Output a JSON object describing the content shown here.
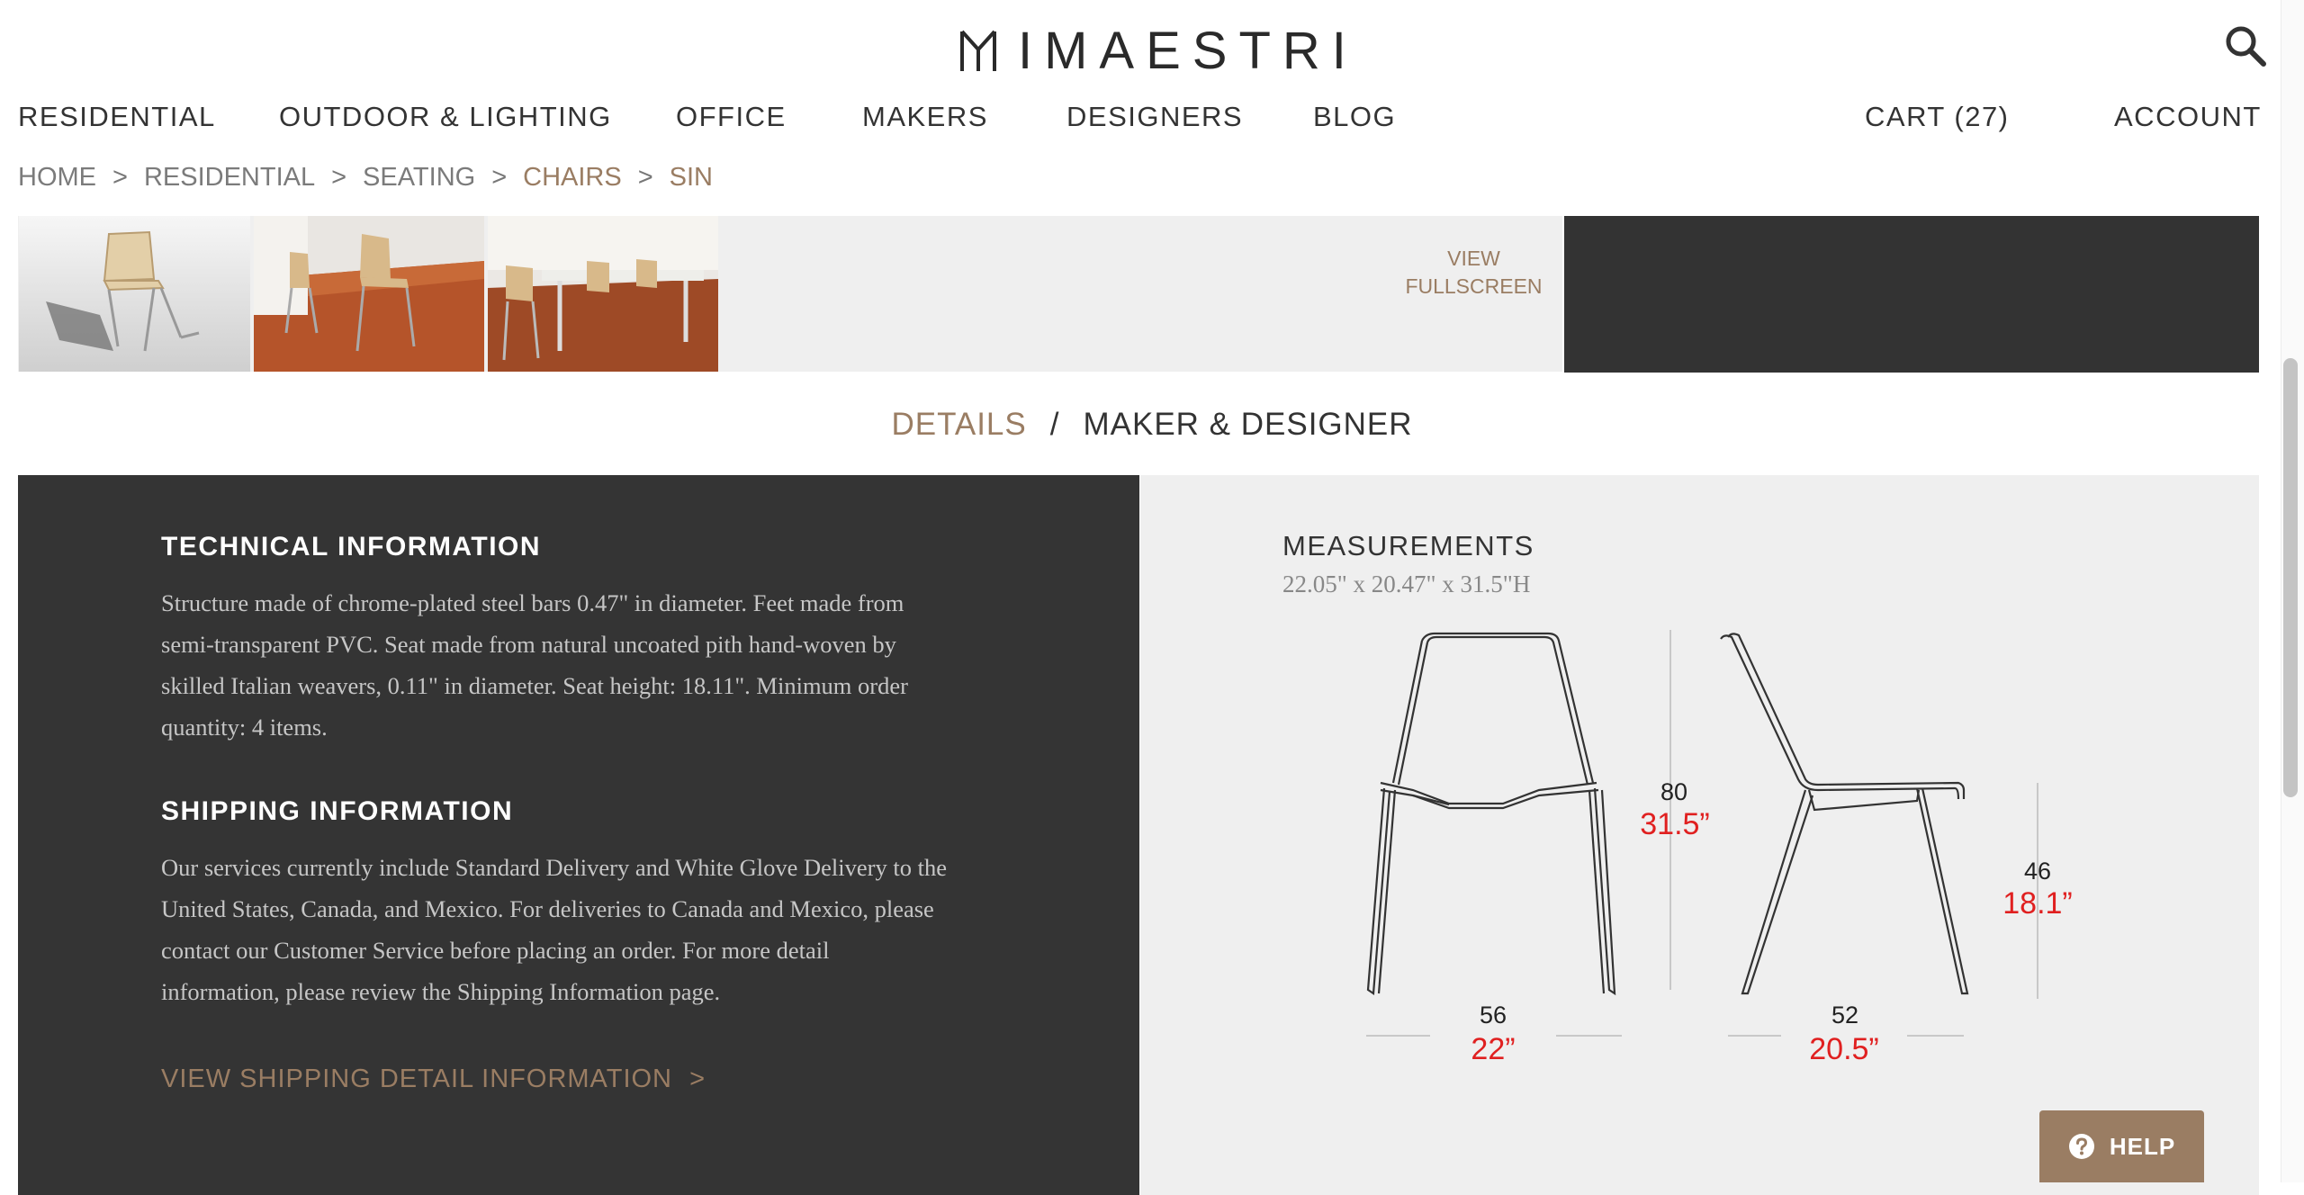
{
  "header": {
    "logo_text": "IMAESTRI",
    "nav": {
      "residential": "RESIDENTIAL",
      "outdoor": "OUTDOOR & LIGHTING",
      "office": "OFFICE",
      "makers": "MAKERS",
      "designers": "DESIGNERS",
      "blog": "BLOG",
      "cart": "CART (27)",
      "account": "ACCOUNT"
    }
  },
  "breadcrumb": {
    "home": "HOME",
    "residential": "RESIDENTIAL",
    "seating": "SEATING",
    "chairs": "CHAIRS",
    "current": "SIN",
    "separator": ">"
  },
  "gallery": {
    "view_fullscreen_line1": "VIEW",
    "view_fullscreen_line2": "FULLSCREEN"
  },
  "tabs": {
    "details": "DETAILS",
    "separator": "/",
    "maker_designer": "MAKER & DESIGNER"
  },
  "technical": {
    "heading": "TECHNICAL INFORMATION",
    "lines": [
      "Structure made of chrome-plated steel bars 0.47\" in diameter. Feet made from",
      "semi-transparent PVC. Seat made from natural uncoated pith hand-woven by",
      "skilled Italian weavers, 0.11\" in diameter. Seat height: 18.11\". Minimum order",
      "quantity: 4 items."
    ]
  },
  "shipping": {
    "heading": "SHIPPING INFORMATION",
    "lines": [
      "Our services currently include Standard Delivery and White Glove Delivery to the",
      "United States, Canada, and Mexico. For deliveries to Canada and Mexico, please",
      "contact our Customer Service before placing an order. For more detail",
      "information, please review the Shipping Information page."
    ],
    "link": "VIEW SHIPPING DETAIL INFORMATION",
    "link_chevron": ">"
  },
  "measurements": {
    "heading": "MEASUREMENTS",
    "summary": "22.05\" x 20.47\" x 31.5\"H",
    "front_height_cm": "80",
    "front_height_in": "31.5”",
    "front_width_cm": "56",
    "front_width_in": "22”",
    "side_seat_cm": "46",
    "side_seat_in": "18.1”",
    "side_depth_cm": "52",
    "side_depth_in": "20.5”"
  },
  "help": {
    "label": "HELP"
  },
  "colors": {
    "accent": "#9a7d63",
    "dark_panel": "#343434",
    "light_panel": "#efefef",
    "dimension_red": "#e02020"
  }
}
